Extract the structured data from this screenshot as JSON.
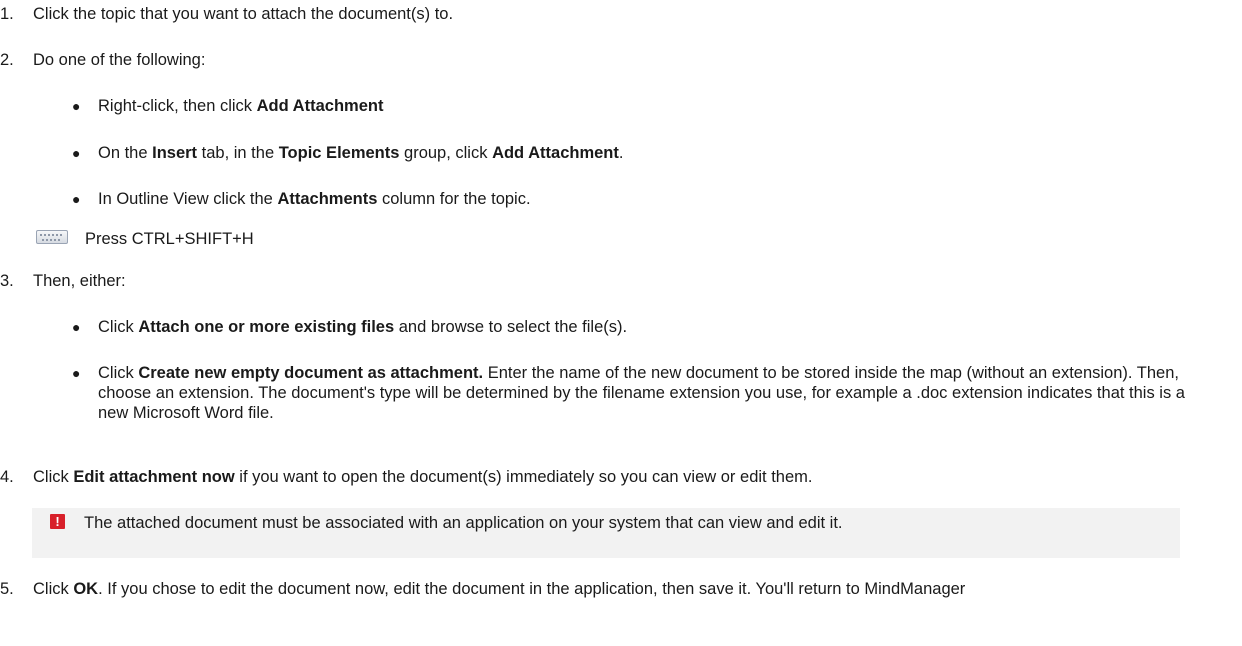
{
  "steps": {
    "s1": {
      "num": "1.",
      "text": "Click the topic that you want to attach the document(s) to."
    },
    "s2": {
      "num": "2.",
      "text": "Do one of the following:",
      "b1": {
        "pre": "Right-click, then click ",
        "bold": "Add Attachment"
      },
      "b2": {
        "pre": "On the ",
        "bold1": "Insert",
        "mid1": " tab, in the ",
        "bold2": "Topic Elements",
        "mid2": " group, click ",
        "bold3": "Add Attachment",
        "post": "."
      },
      "b3": {
        "pre": "In Outline View click the ",
        "bold": "Attachments",
        "post": " column for the topic."
      },
      "shortcut": "Press CTRL+SHIFT+H",
      "shortcut_icon": "keyboard-icon"
    },
    "s3": {
      "num": "3.",
      "text": "Then, either:",
      "b1": {
        "pre": "Click ",
        "bold": "Attach one or more existing files",
        "post": " and browse to select the file(s)."
      },
      "b2": {
        "pre": "Click ",
        "bold": "Create new empty document as attachment.",
        "post": " Enter the name of the new document to be stored inside the map (without an extension). Then, choose an extension. The document's type will be determined by the filename extension you use, for example a .doc extension indicates that this is a new Microsoft Word file."
      }
    },
    "s4": {
      "num": "4.",
      "pre": "Click ",
      "bold": "Edit attachment now",
      "post": " if you want to open the document(s) immediately so you can view or edit them."
    },
    "note": {
      "icon": "warning-icon",
      "icon_glyph": "!",
      "icon_color": "#d8202a",
      "text": "The attached document must be associated with an application on your system that can view and edit it."
    },
    "s5": {
      "num": "5.",
      "pre": "Click ",
      "bold": "OK",
      "post": ". If you chose to edit the document now, edit the document in the application, then save it. You'll return to MindManager"
    }
  }
}
